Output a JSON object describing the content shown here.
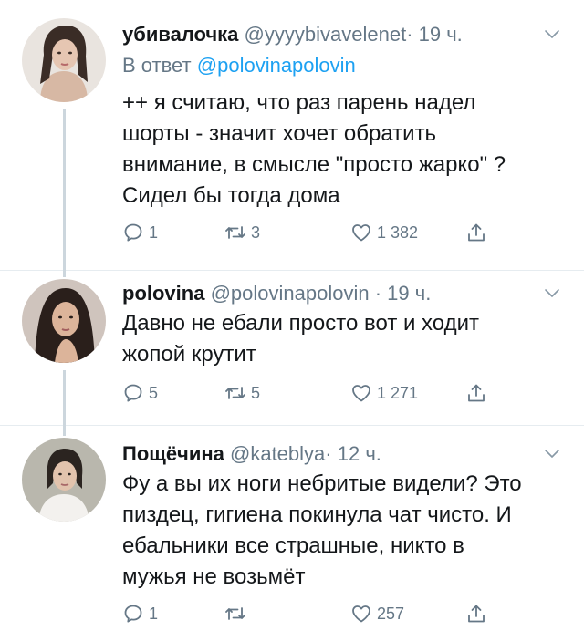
{
  "tweets": [
    {
      "name": "убивалочка",
      "handle": "@yyyybivavelenet",
      "separator": "·",
      "time": "19 ч.",
      "reply_prefix": "В ответ",
      "reply_mention": "@polovinapolovin",
      "text": "++ я считаю, что раз парень надел\nшорты - значит хочет обратить\nвнимание, в смысле \"просто жарко\" ?\nСидел бы тогда дома",
      "replies": "1",
      "retweets": "3",
      "likes": "1 382"
    },
    {
      "name": "polovina",
      "handle": "@polovinapolovin",
      "separator": "·",
      "time": "19 ч.",
      "text": "Давно не ебали просто вот и ходит\nжопой крутит",
      "replies": "5",
      "retweets": "5",
      "likes": "1 271"
    },
    {
      "name": "Пощёчина",
      "handle": "@kateblya",
      "separator": "·",
      "time": "12 ч.",
      "text": "Фу а вы их ноги небритые видели? Это\nпиздец, гигиена покинула чат чисто. И\nебальники все страшные, никто в\nмужья не возьмёт",
      "replies": "1",
      "retweets": "",
      "likes": "257"
    }
  ],
  "icons": {
    "reply": "reply-icon",
    "retweet": "retweet-icon",
    "like": "heart-icon",
    "share": "share-icon",
    "menu": "chevron-down-icon"
  },
  "colors": {
    "text": "#14171a",
    "secondary": "#657786",
    "link": "#1da1f2",
    "divider": "#e6ecf0",
    "thread_line": "#ccd6dd"
  }
}
